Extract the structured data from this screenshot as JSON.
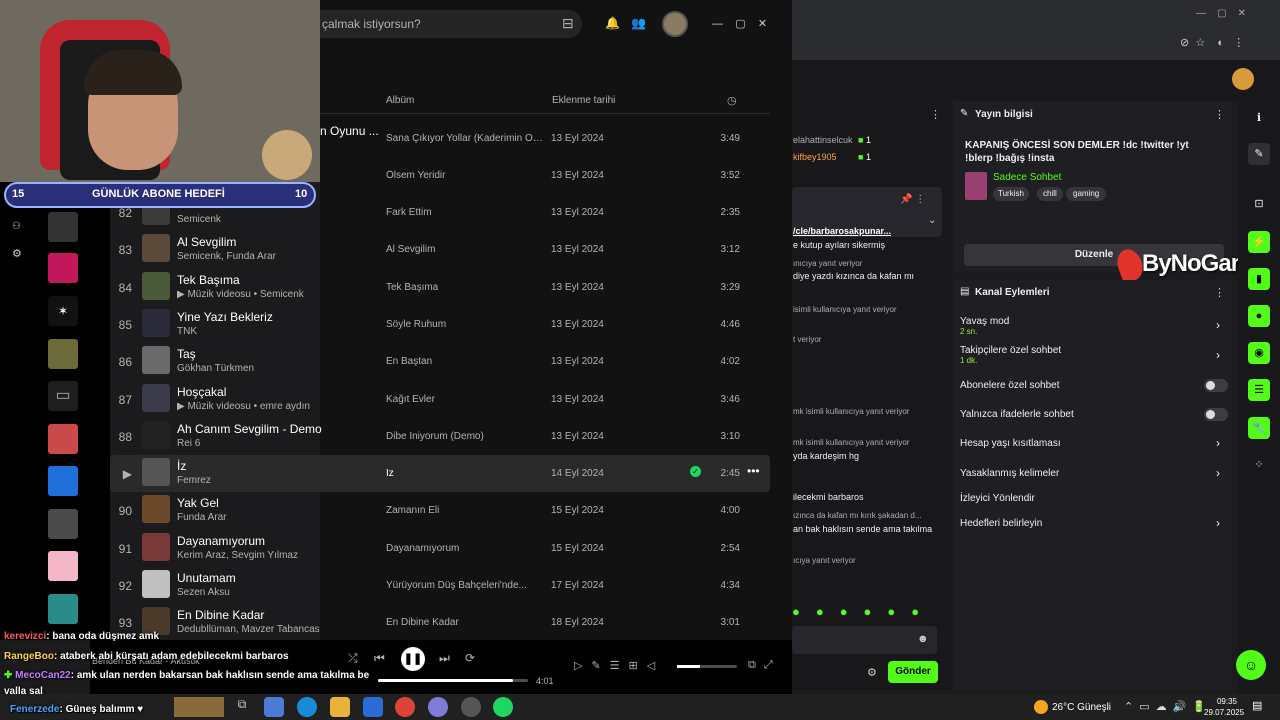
{
  "browser": {
    "tab_controls": [
      "—",
      "▢",
      "✕"
    ]
  },
  "spotify": {
    "search_placeholder": "çalmak istiyorsun?",
    "cols": {
      "album": "Albüm",
      "added": "Eklenme tarihi"
    },
    "partial_top": [
      {
        "title": "n Oyunu ...",
        "album": "Sana Çıkıyor Yollar (Kaderimin Oyu...",
        "date": "13 Eyl 2024",
        "dur": "3:49"
      },
      {
        "title": "",
        "album": "Ölsem Yeridir",
        "date": "13 Eyl 2024",
        "dur": "3:52"
      }
    ],
    "tracks": [
      {
        "n": "82",
        "title": "",
        "artist": "Semicenk",
        "album": "Fark Ettim",
        "date": "13 Eyl 2024",
        "dur": "2:35"
      },
      {
        "n": "83",
        "title": "Al Sevgilim",
        "artist": "Semicenk, Funda Arar",
        "album": "Al Sevgilim",
        "date": "13 Eyl 2024",
        "dur": "3:12"
      },
      {
        "n": "84",
        "title": "Tek Başıma",
        "artist": "▶ Müzik videosu • Semicenk",
        "album": "Tek Başıma",
        "date": "13 Eyl 2024",
        "dur": "3:29"
      },
      {
        "n": "85",
        "title": "Yine Yazı Bekleriz",
        "artist": "TNK",
        "album": "Söyle Ruhum",
        "date": "13 Eyl 2024",
        "dur": "4:46"
      },
      {
        "n": "86",
        "title": "Taş",
        "artist": "Gökhan Türkmen",
        "album": "En Baştan",
        "date": "13 Eyl 2024",
        "dur": "4:02"
      },
      {
        "n": "87",
        "title": "Hoşçakal",
        "artist": "▶ Müzik videosu • emre aydın",
        "album": "Kağıt Evler",
        "date": "13 Eyl 2024",
        "dur": "3:46"
      },
      {
        "n": "88",
        "title": "Ah Canım Sevgilim - Demo",
        "artist": "Rei 6",
        "album": "Dibe İniyorum (Demo)",
        "date": "13 Eyl 2024",
        "dur": "3:10"
      },
      {
        "n": "▶",
        "title": "İz",
        "artist": "Femrez",
        "album": "İz",
        "date": "14 Eyl 2024",
        "dur": "2:45"
      },
      {
        "n": "90",
        "title": "Yak Gel",
        "artist": "Funda Arar",
        "album": "Zamanın Eli",
        "date": "15 Eyl 2024",
        "dur": "4:00"
      },
      {
        "n": "91",
        "title": "Dayanamıyorum",
        "artist": "Kerim Araz, Sevgim Yılmaz",
        "album": "Dayanamıyorum",
        "date": "15 Eyl 2024",
        "dur": "2:54"
      },
      {
        "n": "92",
        "title": "Unutamam",
        "artist": "Sezen Aksu",
        "album": "Yürüyorum Düş Bahçeleri'nde...",
        "date": "17 Eyl 2024",
        "dur": "4:34"
      },
      {
        "n": "93",
        "title": "En Dibine Kadar",
        "artist": "Dedubllüman, Mavzer Tabancas",
        "album": "En Dibine Kadar",
        "date": "18 Eyl 2024",
        "dur": "3:01"
      }
    ],
    "now_playing": "Benden Bu Kadar - Akustik",
    "time_total": "4:01"
  },
  "webcam": {
    "goal_left": "15",
    "goal_label": "GÜNLÜK ABONE HEDEFİ",
    "goal_right": "10"
  },
  "chat": {
    "users": [
      {
        "name": "elahattinselcuk",
        "count": "1"
      },
      {
        "name": "kifbey1905",
        "count": "1"
      }
    ],
    "pinned_link": "/cle/barbarosakpunar...",
    "lines": [
      "e kutup ayıları sikermiş",
      "ınıcıya yanıt veriyor",
      "diye yazdı kızınca da kafan mı",
      "isimli kullanıcıya yanıt veriyor",
      "t veriyor",
      "mk isimli kullanıcıya yanıt veriyor",
      "mk isimli kullanıcıya yanıt veriyor",
      "yda kardeşim hg",
      "ilecekmi barbaros",
      "ızınca da kafan mı kırık şakadan d...",
      "an bak haklısın sende ama takılma",
      "ıcıya yanıt veriyor"
    ],
    "send_label": "Gönder"
  },
  "stream_info": {
    "header": "Yayın bilgisi",
    "title": "KAPANIŞ ÖNCESİ SON DEMLER !dc !twitter !yt !blerp !bağış !insta",
    "category": "Sadece Sohbet",
    "tags": [
      "Turkish",
      "chill",
      "gaming"
    ],
    "edit_label": "Düzenle",
    "watermark": "ByNoGame"
  },
  "channel_actions": {
    "header": "Kanal Eylemleri",
    "items": [
      {
        "label": "Yavaş mod",
        "sub": "2 sn.",
        "type": "chev"
      },
      {
        "label": "Takipçilere özel sohbet",
        "sub": "1 dk.",
        "type": "chev"
      },
      {
        "label": "Abonelere özel sohbet",
        "sub": "",
        "type": "toggle"
      },
      {
        "label": "Yalnızca ifadelerle sohbet",
        "sub": "",
        "type": "toggle"
      },
      {
        "label": "Hesap yaşı kısıtlaması",
        "sub": "",
        "type": "chev"
      },
      {
        "label": "Yasaklanmış kelimeler",
        "sub": "",
        "type": "chev"
      },
      {
        "label": "İzleyici Yönlendir",
        "sub": "",
        "type": "none"
      },
      {
        "label": "Hedefleri belirleyin",
        "sub": "",
        "type": "chev"
      }
    ]
  },
  "overlay_chat": [
    {
      "user": "kerevizci",
      "color": "#ff5c5c",
      "msg": ": bana oda düşmez amk"
    },
    {
      "user": "RangeBoo",
      "color": "#ffd24a",
      "msg": ": ataberk abi kürşatı adam edebilecekmi barbaros"
    },
    {
      "user": "MecoCan22",
      "color": "#c77dff",
      "msg": ": amk ulan nerden bakarsan bak haklısın sende ama takılma be"
    },
    {
      "user": "",
      "color": "#fff",
      "msg": "valla sal"
    },
    {
      "user": "Fenerzede",
      "color": "#4da3ff",
      "msg": ": Güneş balımm ♥"
    }
  ],
  "taskbar": {
    "weather": "26°C Güneşli",
    "time": "09:35",
    "date": "29.07.2025"
  },
  "colors": {
    "spotify_green": "#1ed760",
    "twitch_purple": "#9147ff",
    "kick_green": "#53fc18"
  }
}
